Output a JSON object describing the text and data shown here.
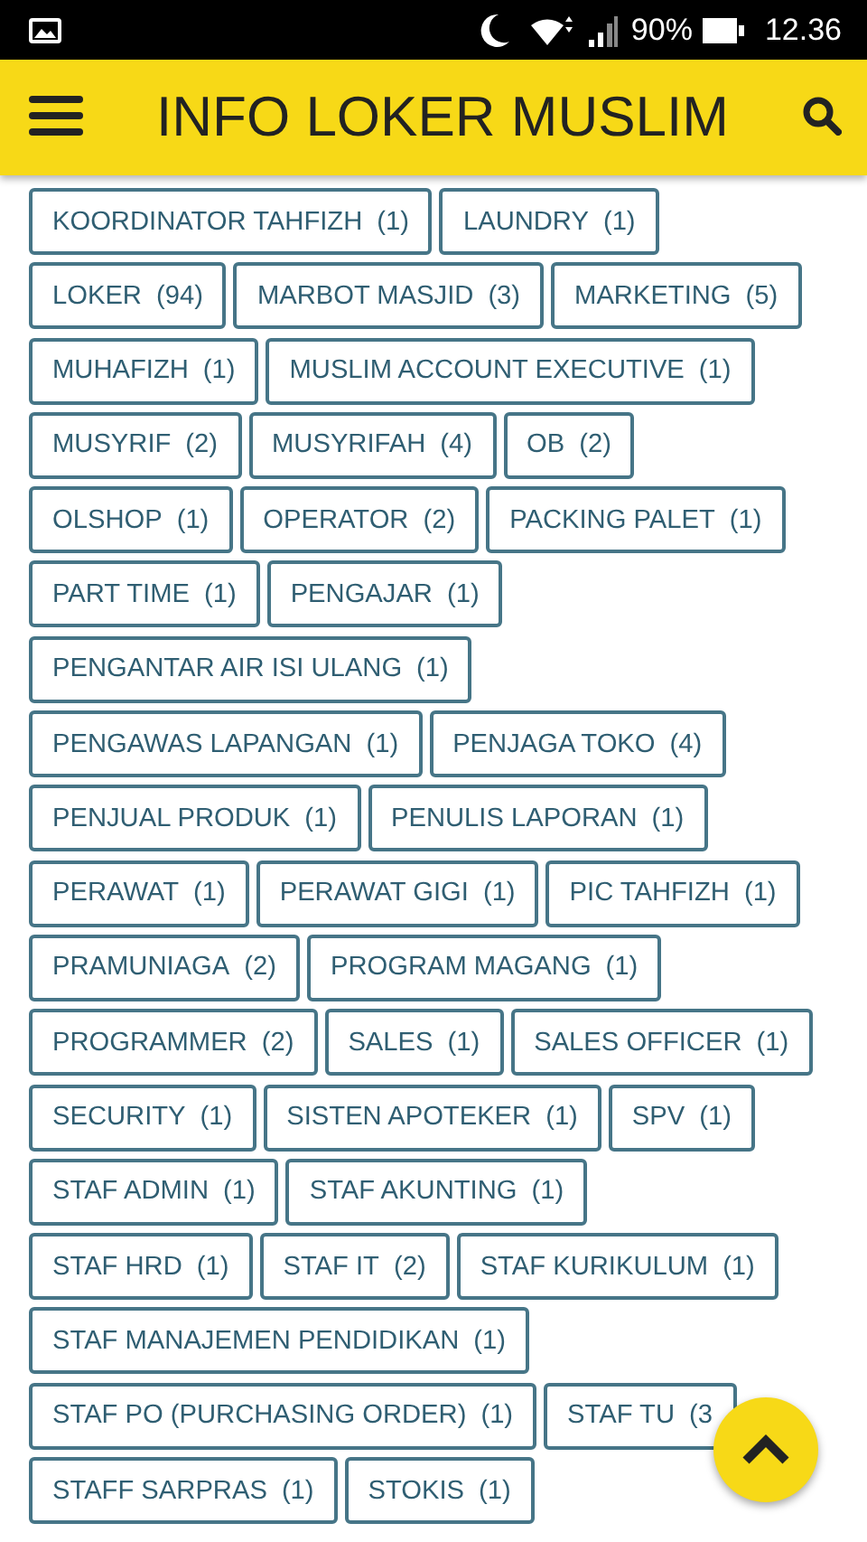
{
  "status_bar": {
    "battery": "90%",
    "time": "12.36"
  },
  "header": {
    "title": "INFO LOKER MUSLIM"
  },
  "tag_rows": [
    [
      {
        "name": "KOORDINATOR TAHFIZH",
        "count": "(1)"
      },
      {
        "name": "LAUNDRY",
        "count": "(1)"
      }
    ],
    [
      {
        "name": "LOKER",
        "count": "(94)"
      },
      {
        "name": "MARBOT MASJID",
        "count": "(3)"
      },
      {
        "name": "MARKETING",
        "count": "(5)"
      }
    ],
    [
      {
        "name": "MUHAFIZH",
        "count": "(1)"
      },
      {
        "name": "MUSLIM ACCOUNT EXECUTIVE",
        "count": "(1)"
      }
    ],
    [
      {
        "name": "MUSYRIF",
        "count": "(2)"
      },
      {
        "name": "MUSYRIFAH",
        "count": "(4)"
      },
      {
        "name": "OB",
        "count": "(2)"
      }
    ],
    [
      {
        "name": "OLSHOP",
        "count": "(1)"
      },
      {
        "name": "OPERATOR",
        "count": "(2)"
      },
      {
        "name": "PACKING PALET",
        "count": "(1)"
      }
    ],
    [
      {
        "name": "PART TIME",
        "count": "(1)"
      },
      {
        "name": "PENGAJAR",
        "count": "(1)"
      }
    ],
    [
      {
        "name": "PENGANTAR AIR ISI ULANG",
        "count": "(1)"
      }
    ],
    [
      {
        "name": "PENGAWAS LAPANGAN",
        "count": "(1)"
      },
      {
        "name": "PENJAGA TOKO",
        "count": "(4)"
      }
    ],
    [
      {
        "name": "PENJUAL PRODUK",
        "count": "(1)"
      },
      {
        "name": "PENULIS LAPORAN",
        "count": "(1)"
      }
    ],
    [
      {
        "name": "PERAWAT",
        "count": "(1)"
      },
      {
        "name": "PERAWAT GIGI",
        "count": "(1)"
      },
      {
        "name": "PIC TAHFIZH",
        "count": "(1)"
      }
    ],
    [
      {
        "name": "PRAMUNIAGA",
        "count": "(2)"
      },
      {
        "name": "PROGRAM MAGANG",
        "count": "(1)"
      }
    ],
    [
      {
        "name": "PROGRAMMER",
        "count": "(2)"
      },
      {
        "name": "SALES",
        "count": "(1)"
      },
      {
        "name": "SALES OFFICER",
        "count": "(1)"
      }
    ],
    [
      {
        "name": "SECURITY",
        "count": "(1)"
      },
      {
        "name": "SISTEN APOTEKER",
        "count": "(1)"
      },
      {
        "name": "SPV",
        "count": "(1)"
      }
    ],
    [
      {
        "name": "STAF ADMIN",
        "count": "(1)"
      },
      {
        "name": "STAF AKUNTING",
        "count": "(1)"
      }
    ],
    [
      {
        "name": "STAF HRD",
        "count": "(1)"
      },
      {
        "name": "STAF IT",
        "count": "(2)"
      },
      {
        "name": "STAF KURIKULUM",
        "count": "(1)"
      }
    ],
    [
      {
        "name": "STAF MANAJEMEN PENDIDIKAN",
        "count": "(1)"
      }
    ],
    [
      {
        "name": "STAF PO (PURCHASING ORDER)",
        "count": "(1)"
      },
      {
        "name": "STAF TU",
        "count": "(3"
      }
    ],
    [
      {
        "name": "STAFF SARPRAS",
        "count": "(1)"
      },
      {
        "name": "STOKIS",
        "count": "(1)"
      }
    ]
  ]
}
